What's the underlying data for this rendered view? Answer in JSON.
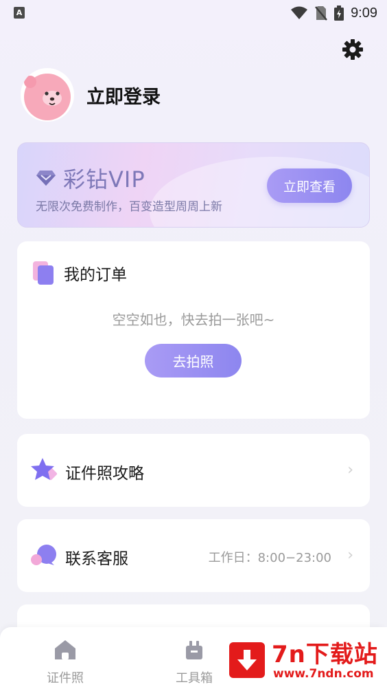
{
  "status_bar": {
    "left_icon_letter": "A",
    "time": "9:09"
  },
  "header": {
    "login_label": "立即登录",
    "settings_icon": "gear-icon"
  },
  "vip": {
    "title": "彩钻VIP",
    "subtitle": "无限次免费制作，百变造型周周上新",
    "button_label": "立即查看",
    "accent": "#8d86ef"
  },
  "orders": {
    "title": "我的订单",
    "empty_text": "空空如也，快去拍一张吧~",
    "button_label": "去拍照"
  },
  "menu": {
    "guide_label": "证件照攻略",
    "service_label": "联系客服",
    "service_hours": "工作日：8:00−23:00"
  },
  "tabbar": {
    "tabs": [
      {
        "label": "证件照",
        "icon": "home-icon"
      },
      {
        "label": "工具箱",
        "icon": "toolbox-icon"
      }
    ]
  },
  "watermark": {
    "title": "7n下载站",
    "url": "www.7ndn.com",
    "color": "#e31b1b"
  }
}
